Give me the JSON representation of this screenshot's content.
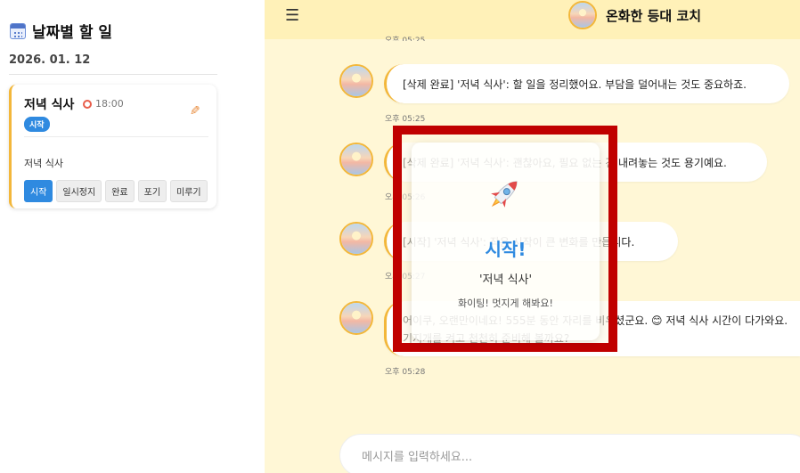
{
  "sidebar": {
    "title": "날짜별 할 일",
    "date": "2026. 01. 12",
    "todo": {
      "title": "저녁 식사",
      "time": "18:00",
      "badge": "시작",
      "description": "저녁 식사",
      "actions": [
        "시작",
        "일시정지",
        "완료",
        "포기",
        "미루기"
      ]
    }
  },
  "header": {
    "menu_icon": "☰",
    "title": "온화한 등대 코치"
  },
  "chat": {
    "top_time_partial": "오후 05:25",
    "messages": [
      {
        "text": "[삭제 완료] '저녁 식사': 할 일을 정리했어요. 부담을 덜어내는 것도 중요하죠.",
        "time": "오후 05:25"
      },
      {
        "text": "[삭제 완료] '저녁 식사': 괜찮아요, 필요 없는 건 내려놓는 것도 용기예요.",
        "time": "오후 05:26"
      },
      {
        "text": "[시작] '저녁 식사': 작은 시작이 큰 변화를 만듭니다.",
        "time": "오후 05:27"
      },
      {
        "text": "어이쿠, 오랜만이네요! 555분 동안 자리를 비우셨군요. 😊 저녁 식사 시간이 다가와요.",
        "text2": "기지개를 켜고 천천히 준비해 볼까요?",
        "time": "오후 05:28"
      }
    ],
    "input_placeholder": "메시지를 입력하세요..."
  },
  "overlay": {
    "icon": "rocket-icon",
    "title": "시작!",
    "task": "'저녁 식사'",
    "message": "화이팅! 멋지게 해봐요!"
  }
}
